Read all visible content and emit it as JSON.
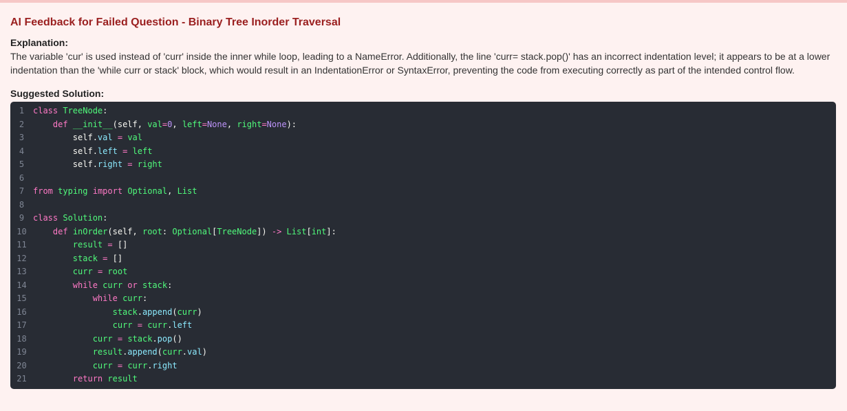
{
  "feedback": {
    "title": "AI Feedback for Failed Question - Binary Tree Inorder Traversal",
    "explanation_label": "Explanation:",
    "explanation_text": "The variable 'cur' is used instead of 'curr' inside the inner while loop, leading to a NameError. Additionally, the line 'curr= stack.pop()' has an incorrect indentation level; it appears to be at a lower indentation than the 'while curr or stack' block, which would result in an IndentationError or SyntaxError, preventing the code from executing correctly as part of the intended control flow.",
    "solution_label": "Suggested Solution:"
  },
  "colors": {
    "title": "#9a1f1f",
    "panel_bg": "#fef2f1",
    "code_bg": "#282c34",
    "keyword": "#ff79c6",
    "name": "#50fa7b",
    "attribute": "#8be9fd",
    "number": "#bd93f9"
  },
  "code": {
    "lines": [
      {
        "n": "1",
        "tokens": [
          [
            "kw",
            "class"
          ],
          [
            "text",
            " "
          ],
          [
            "cls",
            "TreeNode"
          ],
          [
            "text",
            ":"
          ]
        ]
      },
      {
        "n": "2",
        "tokens": [
          [
            "text",
            "    "
          ],
          [
            "kw",
            "def"
          ],
          [
            "text",
            " "
          ],
          [
            "fn",
            "__init__"
          ],
          [
            "text",
            "(self, "
          ],
          [
            "param",
            "val"
          ],
          [
            "op",
            "="
          ],
          [
            "num",
            "0"
          ],
          [
            "text",
            ", "
          ],
          [
            "param",
            "left"
          ],
          [
            "op",
            "="
          ],
          [
            "none",
            "None"
          ],
          [
            "text",
            ", "
          ],
          [
            "param",
            "right"
          ],
          [
            "op",
            "="
          ],
          [
            "none",
            "None"
          ],
          [
            "text",
            "):"
          ]
        ]
      },
      {
        "n": "3",
        "tokens": [
          [
            "text",
            "        self."
          ],
          [
            "attr",
            "val"
          ],
          [
            "text",
            " "
          ],
          [
            "op",
            "="
          ],
          [
            "text",
            " "
          ],
          [
            "param",
            "val"
          ]
        ]
      },
      {
        "n": "4",
        "tokens": [
          [
            "text",
            "        self."
          ],
          [
            "attr",
            "left"
          ],
          [
            "text",
            " "
          ],
          [
            "op",
            "="
          ],
          [
            "text",
            " "
          ],
          [
            "param",
            "left"
          ]
        ]
      },
      {
        "n": "5",
        "tokens": [
          [
            "text",
            "        self."
          ],
          [
            "attr",
            "right"
          ],
          [
            "text",
            " "
          ],
          [
            "op",
            "="
          ],
          [
            "text",
            " "
          ],
          [
            "param",
            "right"
          ]
        ]
      },
      {
        "n": "6",
        "tokens": []
      },
      {
        "n": "7",
        "tokens": [
          [
            "kw",
            "from"
          ],
          [
            "text",
            " "
          ],
          [
            "cls",
            "typing"
          ],
          [
            "text",
            " "
          ],
          [
            "kw",
            "import"
          ],
          [
            "text",
            " "
          ],
          [
            "cls",
            "Optional"
          ],
          [
            "text",
            ", "
          ],
          [
            "cls",
            "List"
          ]
        ]
      },
      {
        "n": "8",
        "tokens": []
      },
      {
        "n": "9",
        "tokens": [
          [
            "kw",
            "class"
          ],
          [
            "text",
            " "
          ],
          [
            "cls",
            "Solution"
          ],
          [
            "text",
            ":"
          ]
        ]
      },
      {
        "n": "10",
        "tokens": [
          [
            "text",
            "    "
          ],
          [
            "kw",
            "def"
          ],
          [
            "text",
            " "
          ],
          [
            "fn",
            "inOrder"
          ],
          [
            "text",
            "(self, "
          ],
          [
            "param",
            "root"
          ],
          [
            "text",
            ": "
          ],
          [
            "cls",
            "Optional"
          ],
          [
            "text",
            "["
          ],
          [
            "cls",
            "TreeNode"
          ],
          [
            "text",
            "]) "
          ],
          [
            "op",
            "->"
          ],
          [
            "text",
            " "
          ],
          [
            "cls",
            "List"
          ],
          [
            "text",
            "["
          ],
          [
            "cls",
            "int"
          ],
          [
            "text",
            "]:"
          ]
        ]
      },
      {
        "n": "11",
        "tokens": [
          [
            "text",
            "        "
          ],
          [
            "param",
            "result"
          ],
          [
            "text",
            " "
          ],
          [
            "op",
            "="
          ],
          [
            "text",
            " []"
          ]
        ]
      },
      {
        "n": "12",
        "tokens": [
          [
            "text",
            "        "
          ],
          [
            "param",
            "stack"
          ],
          [
            "text",
            " "
          ],
          [
            "op",
            "="
          ],
          [
            "text",
            " []"
          ]
        ]
      },
      {
        "n": "13",
        "tokens": [
          [
            "text",
            "        "
          ],
          [
            "param",
            "curr"
          ],
          [
            "text",
            " "
          ],
          [
            "op",
            "="
          ],
          [
            "text",
            " "
          ],
          [
            "param",
            "root"
          ]
        ]
      },
      {
        "n": "14",
        "tokens": [
          [
            "text",
            "        "
          ],
          [
            "kw",
            "while"
          ],
          [
            "text",
            " "
          ],
          [
            "param",
            "curr"
          ],
          [
            "text",
            " "
          ],
          [
            "kw",
            "or"
          ],
          [
            "text",
            " "
          ],
          [
            "param",
            "stack"
          ],
          [
            "text",
            ":"
          ]
        ]
      },
      {
        "n": "15",
        "tokens": [
          [
            "text",
            "            "
          ],
          [
            "kw",
            "while"
          ],
          [
            "text",
            " "
          ],
          [
            "param",
            "curr"
          ],
          [
            "text",
            ":"
          ]
        ]
      },
      {
        "n": "16",
        "tokens": [
          [
            "text",
            "                "
          ],
          [
            "param",
            "stack"
          ],
          [
            "text",
            "."
          ],
          [
            "attr",
            "append"
          ],
          [
            "text",
            "("
          ],
          [
            "param",
            "curr"
          ],
          [
            "text",
            ")"
          ]
        ]
      },
      {
        "n": "17",
        "tokens": [
          [
            "text",
            "                "
          ],
          [
            "param",
            "curr"
          ],
          [
            "text",
            " "
          ],
          [
            "op",
            "="
          ],
          [
            "text",
            " "
          ],
          [
            "param",
            "curr"
          ],
          [
            "text",
            "."
          ],
          [
            "attr",
            "left"
          ]
        ]
      },
      {
        "n": "18",
        "tokens": [
          [
            "text",
            "            "
          ],
          [
            "param",
            "curr"
          ],
          [
            "text",
            " "
          ],
          [
            "op",
            "="
          ],
          [
            "text",
            " "
          ],
          [
            "param",
            "stack"
          ],
          [
            "text",
            "."
          ],
          [
            "attr",
            "pop"
          ],
          [
            "text",
            "()"
          ]
        ]
      },
      {
        "n": "19",
        "tokens": [
          [
            "text",
            "            "
          ],
          [
            "param",
            "result"
          ],
          [
            "text",
            "."
          ],
          [
            "attr",
            "append"
          ],
          [
            "text",
            "("
          ],
          [
            "param",
            "curr"
          ],
          [
            "text",
            "."
          ],
          [
            "attr",
            "val"
          ],
          [
            "text",
            ")"
          ]
        ]
      },
      {
        "n": "20",
        "tokens": [
          [
            "text",
            "            "
          ],
          [
            "param",
            "curr"
          ],
          [
            "text",
            " "
          ],
          [
            "op",
            "="
          ],
          [
            "text",
            " "
          ],
          [
            "param",
            "curr"
          ],
          [
            "text",
            "."
          ],
          [
            "attr",
            "right"
          ]
        ]
      },
      {
        "n": "21",
        "tokens": [
          [
            "text",
            "        "
          ],
          [
            "kw",
            "return"
          ],
          [
            "text",
            " "
          ],
          [
            "param",
            "result"
          ]
        ]
      }
    ]
  }
}
